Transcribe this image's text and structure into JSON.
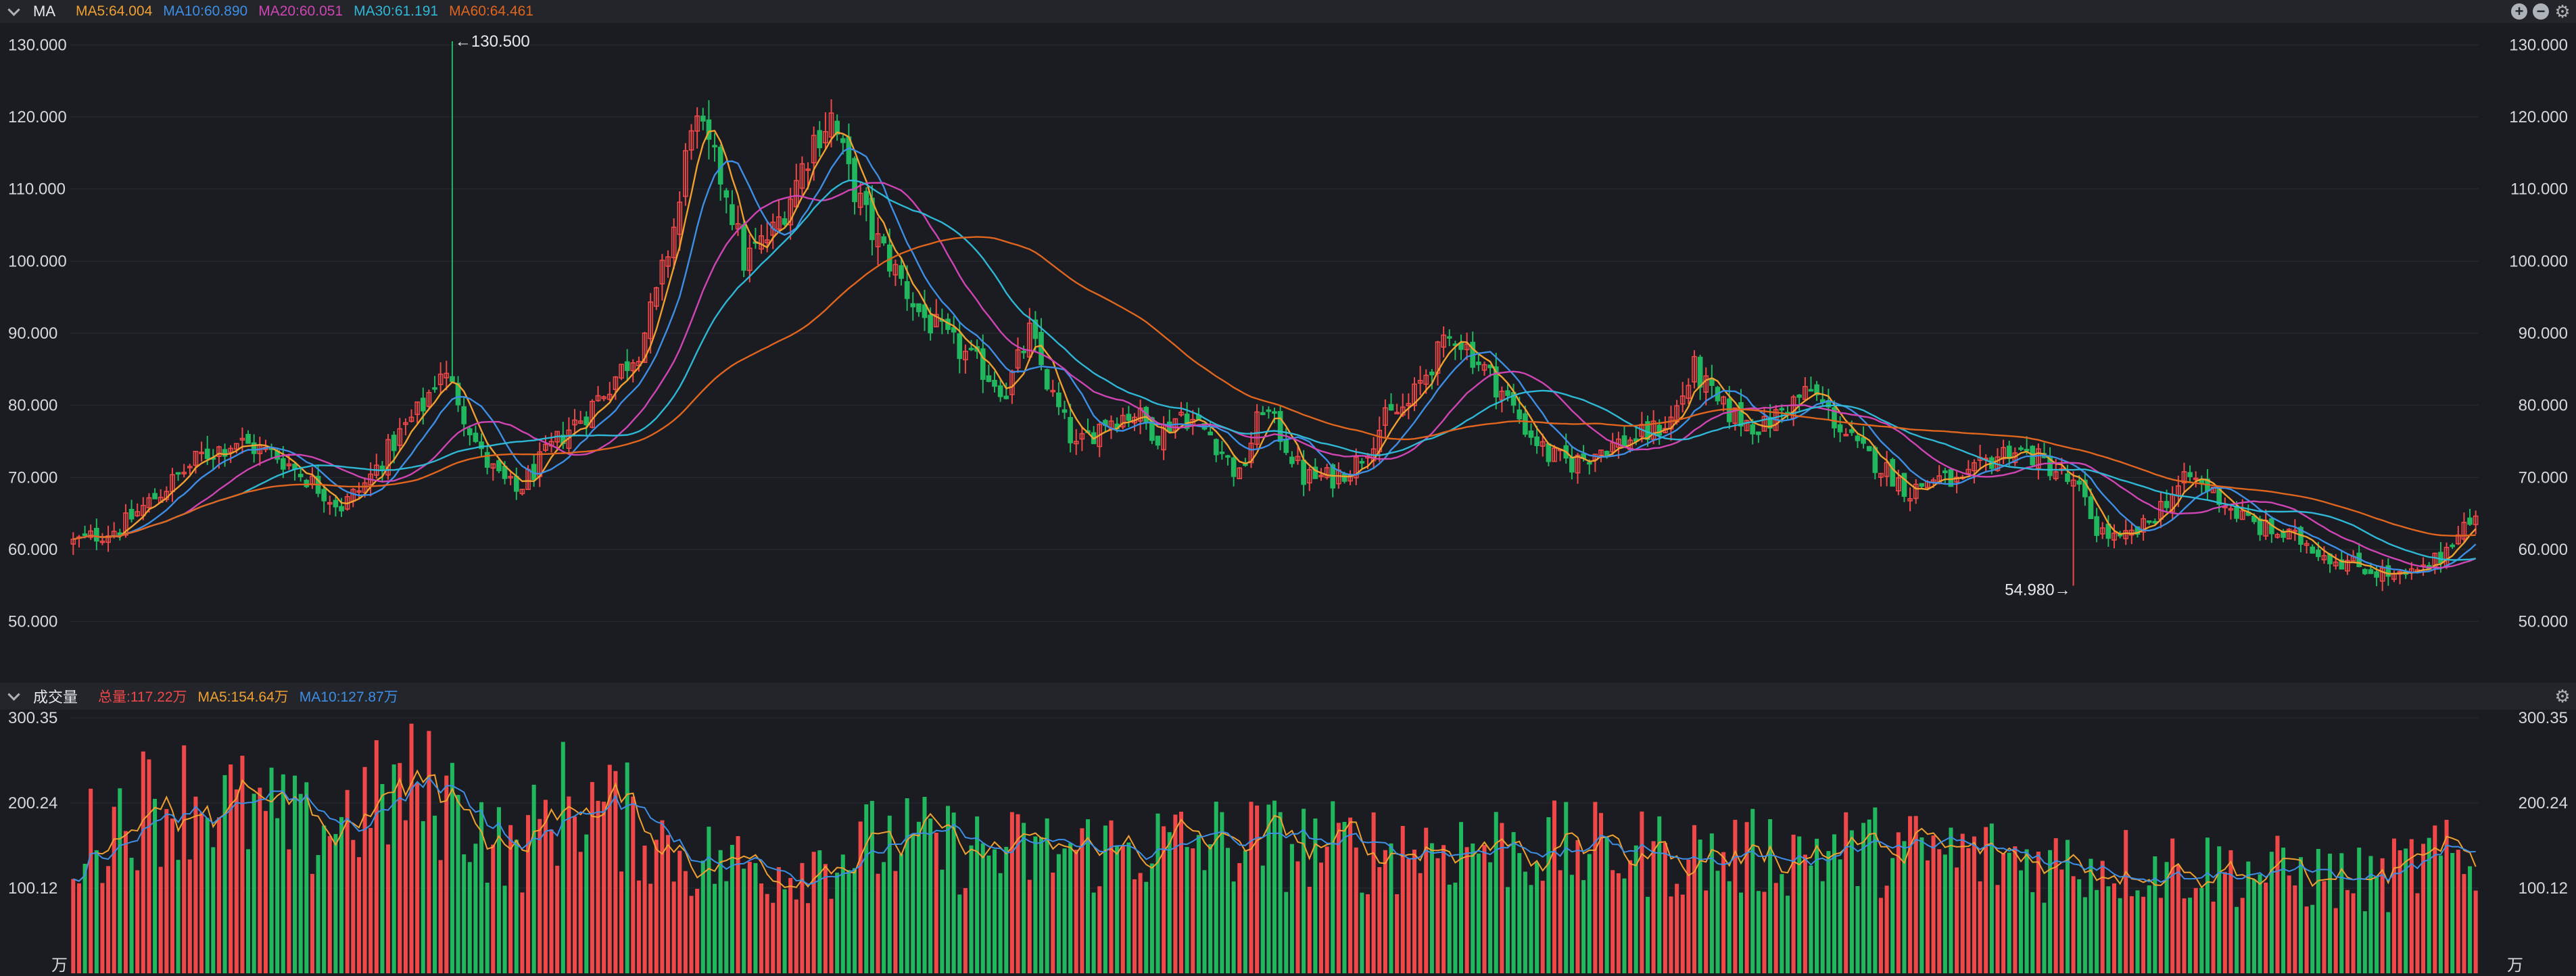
{
  "price_panel": {
    "indicator_name": "MA",
    "ma_legend": [
      {
        "label": "MA5:64.004",
        "color": "#f0a030"
      },
      {
        "label": "MA10:60.890",
        "color": "#3d8fe6"
      },
      {
        "label": "MA20:60.051",
        "color": "#d045b4"
      },
      {
        "label": "MA30:61.191",
        "color": "#2fb8d6"
      },
      {
        "label": "MA60:64.461",
        "color": "#e0651f"
      }
    ],
    "icons": [
      "plus-circle-icon",
      "minus-circle-icon",
      "gear-icon"
    ]
  },
  "volume_panel": {
    "indicator_name": "成交量",
    "legend": [
      {
        "label": "总量:117.22万",
        "color": "#f04848"
      },
      {
        "label": "MA5:154.64万",
        "color": "#f0a030"
      },
      {
        "label": "MA10:127.87万",
        "color": "#3d8fe6"
      }
    ],
    "unit": "万",
    "icons": [
      "gear-icon"
    ]
  },
  "colors": {
    "up": "#f04848",
    "down": "#21b75f",
    "background": "#1b1c21",
    "axis_text": "#d6d8dc"
  },
  "chart_data": [
    {
      "type": "candlestick",
      "title": "",
      "ylim": [
        42,
        132
      ],
      "yticks": [
        "130.000",
        "120.000",
        "110.000",
        "100.000",
        "90.000",
        "80.000",
        "70.000",
        "60.000",
        "50.000"
      ],
      "ytick_values": [
        130,
        120,
        110,
        100,
        90,
        80,
        70,
        60,
        50
      ],
      "annotations": [
        {
          "text": "←130.500",
          "value": 130.5,
          "index": 65
        },
        {
          "text": "54.980→",
          "value": 54.98,
          "index": 343
        }
      ],
      "close_anchors": [
        [
          0,
          61
        ],
        [
          8,
          63
        ],
        [
          15,
          68
        ],
        [
          22,
          73
        ],
        [
          28,
          75
        ],
        [
          35,
          73
        ],
        [
          40,
          70
        ],
        [
          46,
          66
        ],
        [
          50,
          69
        ],
        [
          56,
          76
        ],
        [
          60,
          80
        ],
        [
          63,
          85
        ],
        [
          66,
          81
        ],
        [
          70,
          73
        ],
        [
          73,
          70
        ],
        [
          76,
          68
        ],
        [
          80,
          72
        ],
        [
          84,
          76
        ],
        [
          88,
          79
        ],
        [
          92,
          83
        ],
        [
          97,
          88
        ],
        [
          100,
          95
        ],
        [
          104,
          108
        ],
        [
          106,
          120
        ],
        [
          108,
          117
        ],
        [
          112,
          110
        ],
        [
          115,
          100
        ],
        [
          120,
          104
        ],
        [
          124,
          111
        ],
        [
          127,
          117
        ],
        [
          130,
          120
        ],
        [
          133,
          112
        ],
        [
          137,
          104
        ],
        [
          140,
          100
        ],
        [
          145,
          93
        ],
        [
          150,
          89
        ],
        [
          156,
          85
        ],
        [
          160,
          82
        ],
        [
          164,
          90
        ],
        [
          168,
          81
        ],
        [
          172,
          74
        ],
        [
          177,
          78
        ],
        [
          182,
          79
        ],
        [
          186,
          76
        ],
        [
          190,
          79
        ],
        [
          195,
          76
        ],
        [
          200,
          70
        ],
        [
          204,
          80
        ],
        [
          207,
          76
        ],
        [
          211,
          70
        ],
        [
          216,
          70
        ],
        [
          220,
          72
        ],
        [
          225,
          78
        ],
        [
          229,
          80
        ],
        [
          233,
          86
        ],
        [
          237,
          90
        ],
        [
          241,
          86
        ],
        [
          245,
          82
        ],
        [
          249,
          77
        ],
        [
          253,
          73
        ],
        [
          257,
          72
        ],
        [
          262,
          74
        ],
        [
          266,
          75
        ],
        [
          270,
          76
        ],
        [
          274,
          78
        ],
        [
          278,
          85
        ],
        [
          282,
          80
        ],
        [
          286,
          78
        ],
        [
          290,
          77
        ],
        [
          294,
          80
        ],
        [
          298,
          82
        ],
        [
          302,
          78
        ],
        [
          306,
          74
        ],
        [
          311,
          71
        ],
        [
          315,
          68
        ],
        [
          319,
          70
        ],
        [
          324,
          69
        ],
        [
          328,
          72
        ],
        [
          332,
          74
        ],
        [
          336,
          73
        ],
        [
          340,
          71
        ],
        [
          344,
          68
        ],
        [
          347,
          63
        ],
        [
          351,
          61
        ],
        [
          355,
          63
        ],
        [
          359,
          67
        ],
        [
          363,
          70
        ],
        [
          367,
          68
        ],
        [
          371,
          65
        ],
        [
          375,
          63
        ],
        [
          379,
          62
        ],
        [
          383,
          61
        ],
        [
          387,
          59
        ],
        [
          391,
          58
        ],
        [
          395,
          57
        ],
        [
          399,
          56
        ],
        [
          403,
          57
        ],
        [
          406,
          59
        ],
        [
          409,
          63
        ],
        [
          412,
          64
        ]
      ],
      "moving_averages": [
        {
          "name": "MA5",
          "color": "#f0a030"
        },
        {
          "name": "MA10",
          "color": "#3d8fe6"
        },
        {
          "name": "MA20",
          "color": "#d045b4"
        },
        {
          "name": "MA30",
          "color": "#2fb8d6"
        },
        {
          "name": "MA60",
          "color": "#e0651f"
        }
      ]
    },
    {
      "type": "bar",
      "title": "",
      "ylim": [
        0,
        300.35
      ],
      "yticks": [
        "300.35",
        "200.24",
        "100.12"
      ],
      "ytick_values": [
        300.35,
        200.24,
        100.12
      ],
      "unit": "万",
      "volume_anchors": [
        [
          0,
          150
        ],
        [
          10,
          200
        ],
        [
          20,
          215
        ],
        [
          30,
          195
        ],
        [
          40,
          170
        ],
        [
          50,
          200
        ],
        [
          58,
          225
        ],
        [
          66,
          205
        ],
        [
          75,
          140
        ],
        [
          85,
          215
        ],
        [
          95,
          185
        ],
        [
          105,
          140
        ],
        [
          120,
          125
        ],
        [
          140,
          160
        ],
        [
          160,
          145
        ],
        [
          180,
          150
        ],
        [
          200,
          160
        ],
        [
          220,
          150
        ],
        [
          240,
          155
        ],
        [
          260,
          150
        ],
        [
          280,
          140
        ],
        [
          300,
          150
        ],
        [
          320,
          145
        ],
        [
          340,
          135
        ],
        [
          360,
          130
        ],
        [
          380,
          120
        ],
        [
          395,
          110
        ],
        [
          405,
          140
        ],
        [
          412,
          120
        ]
      ],
      "moving_averages": [
        {
          "name": "MA5",
          "color": "#f0a030"
        },
        {
          "name": "MA10",
          "color": "#3d8fe6"
        }
      ]
    }
  ]
}
